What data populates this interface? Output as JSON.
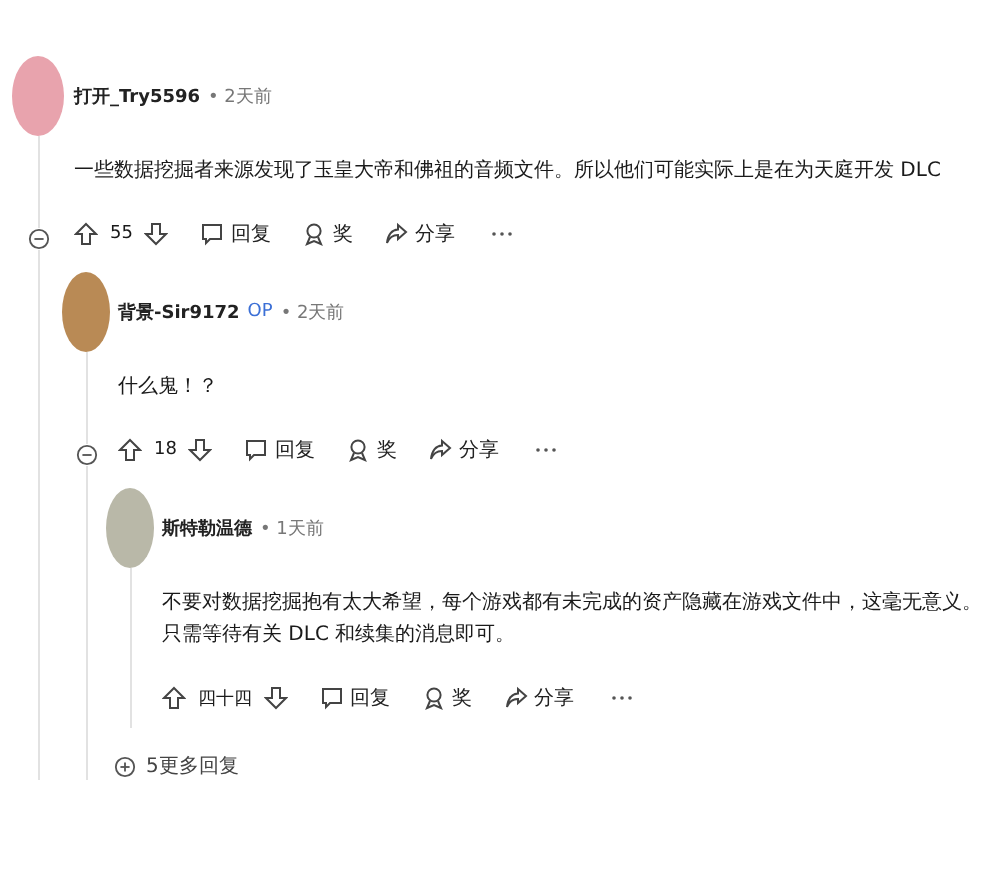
{
  "comments": [
    {
      "author": "打开_Try5596",
      "time": "• 2天前",
      "color": "#e8a3ad",
      "body": "一些数据挖掘者来源发现了玉皇大帝和佛祖的音频文件。所以他们可能实际上是在为天庭开发 DLC",
      "votes": "55",
      "collapsible": true,
      "reply": "回复",
      "award": "奖",
      "share": "分享",
      "replies": [
        {
          "author": "背景-Sir9172",
          "op_badge": "OP",
          "time": "• 2天前",
          "color": "#b98a55",
          "body": "什么鬼！？",
          "votes": "18",
          "collapsible": true,
          "reply": "回复",
          "award": "奖",
          "share": "分享",
          "more_replies": "5更多回复",
          "replies": [
            {
              "author": "斯特勒温德",
              "time": "• 1天前",
              "color": "#b9b8a8",
              "body": "不要对数据挖掘抱有太大希望，每个游戏都有未完成的资产隐藏在游戏文件中，这毫无意义。只需等待有关 DLC 和续集的消息即可。",
              "votes": "四十四",
              "collapsible": false,
              "reply": "回复",
              "award": "奖",
              "share": "分享"
            }
          ]
        }
      ]
    }
  ]
}
